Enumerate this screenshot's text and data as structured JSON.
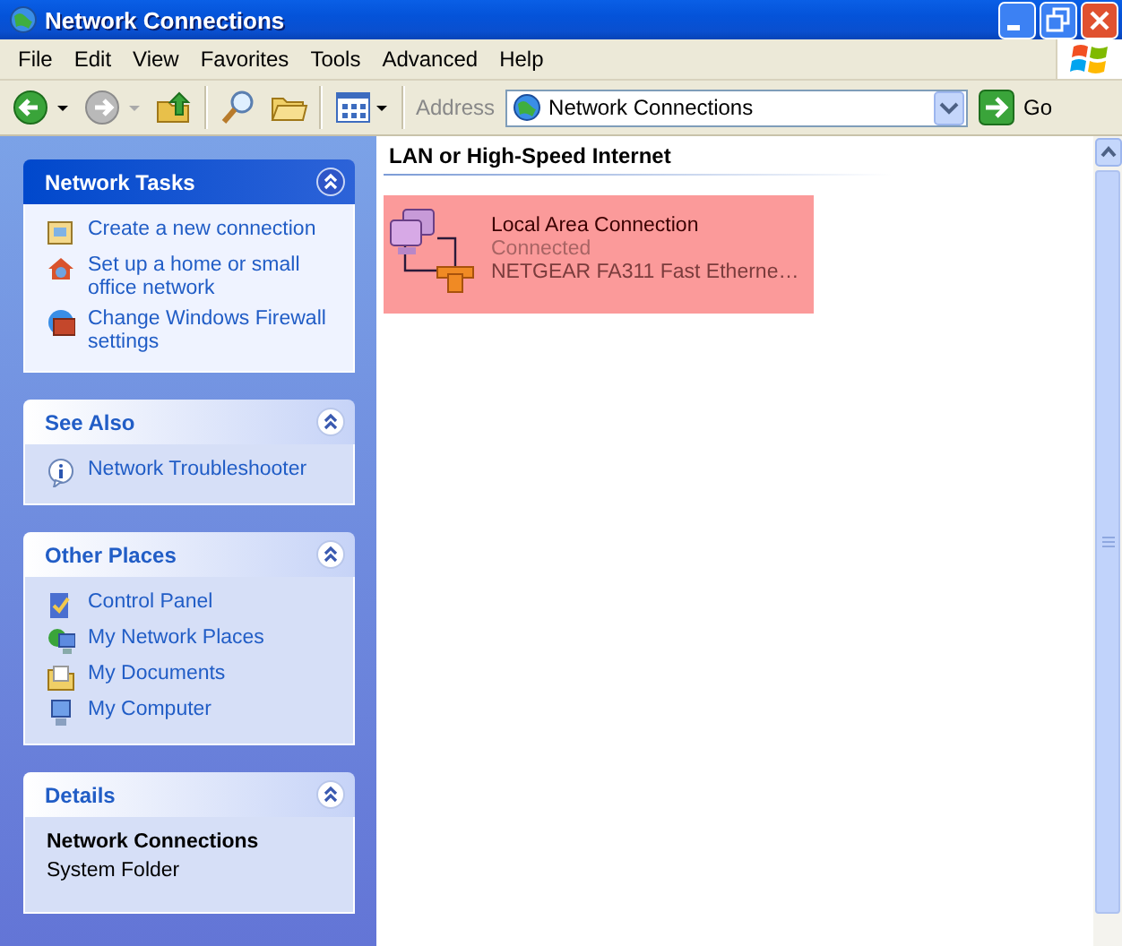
{
  "window": {
    "title": "Network Connections"
  },
  "menu": [
    "File",
    "Edit",
    "View",
    "Favorites",
    "Tools",
    "Advanced",
    "Help"
  ],
  "toolbar": {
    "address_label": "Address",
    "address": "Network Connections",
    "go": "Go"
  },
  "sidebar": {
    "panels": [
      {
        "title": "Network Tasks",
        "primary": true,
        "expanded": true,
        "kind": "links",
        "items": [
          "Create a new connection",
          "Set up a home or small office network",
          "Change Windows Firewall settings"
        ]
      },
      {
        "title": "See Also",
        "primary": false,
        "expanded": true,
        "kind": "links",
        "items": [
          "Network Troubleshooter"
        ]
      },
      {
        "title": "Other Places",
        "primary": false,
        "expanded": true,
        "kind": "links",
        "items": [
          "Control Panel",
          "My Network Places",
          "My Documents",
          "My Computer"
        ]
      },
      {
        "title": "Details",
        "primary": false,
        "expanded": true,
        "kind": "details",
        "name": "Network Connections",
        "description": "System Folder"
      }
    ]
  },
  "content": {
    "groups": [
      {
        "heading": "LAN or High-Speed Internet",
        "items": [
          {
            "name": "Local Area Connection",
            "status": "Connected",
            "device": "NETGEAR FA311 Fast Etherne…",
            "selected": true
          }
        ]
      }
    ]
  }
}
